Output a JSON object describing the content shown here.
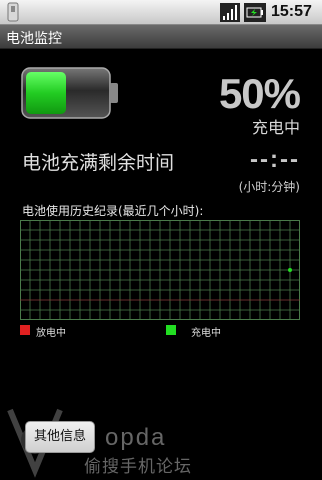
{
  "status_bar": {
    "time": "15:57",
    "icons": [
      "usb-icon",
      "signal-icon",
      "battery-status-icon"
    ]
  },
  "title_bar": {
    "title": "电池监控"
  },
  "battery": {
    "level": 0.5,
    "fill_color": "#22dd22",
    "percent_text": "50%",
    "state_text": "充电中"
  },
  "remaining": {
    "label": "电池充满剩余时间",
    "value": "--:--",
    "unit": "(小时:分钟)"
  },
  "history": {
    "title": "电池使用历史纪录(最近几个小时):",
    "grid_color": "#4a7a4a",
    "baseline_color": "#8a3a3a",
    "point_color": "#22dd22"
  },
  "legend": [
    {
      "label": "放电中",
      "color": "#e02020"
    },
    {
      "label": "充电中",
      "color": "#22dd22"
    }
  ],
  "actions": {
    "more_info": "其他信息"
  },
  "watermark": {
    "brand": "opda",
    "tagline": "偷搜手机论坛"
  }
}
